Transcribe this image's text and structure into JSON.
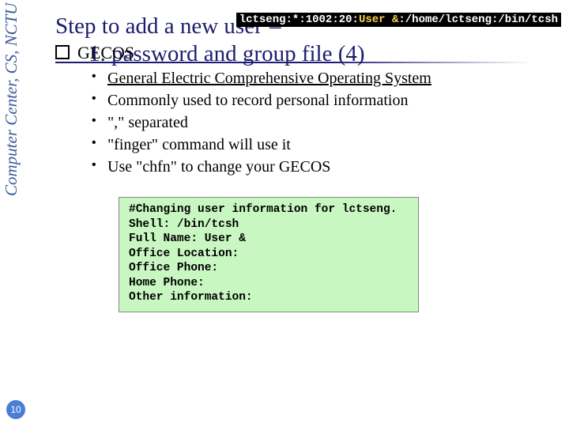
{
  "sidebar": {
    "label": "Computer Center, CS, NCTU"
  },
  "page_number": "10",
  "code_inline": {
    "pre": "lctseng:*:1002:20:",
    "hl": "User &",
    "post": ":/home/lctseng:/bin/tcsh"
  },
  "title": {
    "line1_prefix": "Step to add a new user ",
    "dash": "–",
    "line2": "1. password and group file (4)"
  },
  "section": {
    "label": "GECOS"
  },
  "bullets": [
    "General Electric Comprehensive Operating System",
    "Commonly used to record personal information",
    "\",\" separated",
    "\"finger\" command will use it",
    "Use \"chfn\" to change your GECOS"
  ],
  "terminal": "#Changing user information for lctseng.\nShell: /bin/tcsh\nFull Name: User &\nOffice Location:\nOffice Phone:\nHome Phone:\nOther information:"
}
